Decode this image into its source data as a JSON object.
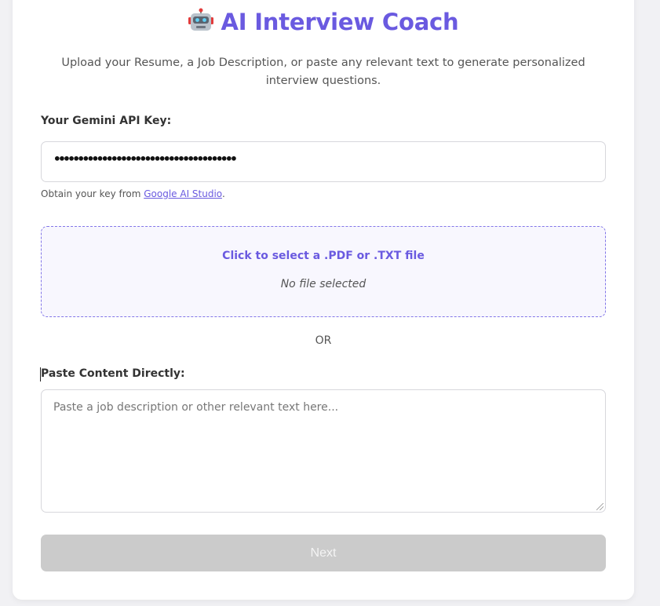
{
  "header": {
    "icon": "robot-icon",
    "title": "AI Interview Coach",
    "subtitle": "Upload your Resume, a Job Description, or paste any relevant text to generate personalized interview questions."
  },
  "api_key": {
    "label": "Your Gemini API Key:",
    "masked_value": "••••••••••••••••••••••••••••••••••••••",
    "hint_prefix": "Obtain your key from ",
    "hint_link": "Google AI Studio",
    "hint_suffix": "."
  },
  "upload": {
    "prompt": "Click to select a .PDF or .TXT file",
    "status": "No file selected"
  },
  "separator": "OR",
  "paste": {
    "label": "Paste Content Directly:",
    "placeholder": "Paste a job description or other relevant text here..."
  },
  "next_button": "Next",
  "colors": {
    "accent": "#6a5ae0",
    "disabled_button": "#cbcbcb",
    "page_background": "#f1f1f4"
  }
}
